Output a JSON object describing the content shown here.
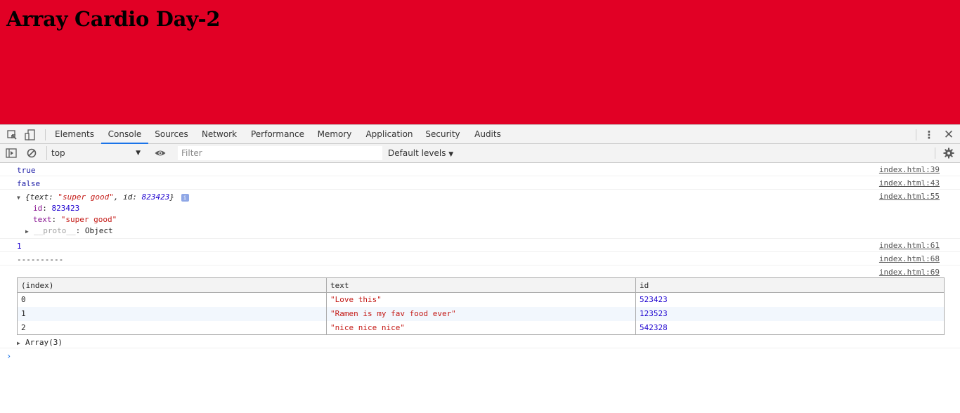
{
  "page": {
    "heading": "Array Cardio Day-2",
    "background": "#e10025"
  },
  "devtools": {
    "tabs": [
      {
        "label": "Elements",
        "active": false
      },
      {
        "label": "Console",
        "active": true
      },
      {
        "label": "Sources",
        "active": false
      },
      {
        "label": "Network",
        "active": false
      },
      {
        "label": "Performance",
        "active": false
      },
      {
        "label": "Memory",
        "active": false
      },
      {
        "label": "Application",
        "active": false
      },
      {
        "label": "Security",
        "active": false
      },
      {
        "label": "Audits",
        "active": false
      }
    ],
    "toolbar": {
      "context": "top",
      "filter_placeholder": "Filter",
      "levels": "Default levels"
    }
  },
  "console": {
    "messages": [
      {
        "text": "true",
        "source": "index.html:39"
      },
      {
        "text": "false",
        "source": "index.html:43"
      },
      {
        "source": "index.html:55",
        "summary_prefix": "{text: ",
        "summary_text": "\"super good\"",
        "summary_mid": ", id: ",
        "summary_id": "823423",
        "summary_suffix": "}",
        "info_badge": "i",
        "props": [
          {
            "key": "id",
            "value": "823423"
          },
          {
            "key": "text",
            "value": "\"super good\""
          },
          {
            "key": "__proto__",
            "value": "Object"
          }
        ]
      },
      {
        "text": "1",
        "source": "index.html:61"
      },
      {
        "text": "----------",
        "source": "index.html:68"
      },
      {
        "source": "index.html:69"
      }
    ],
    "table": {
      "headers": [
        "(index)",
        "text",
        "id"
      ],
      "rows": [
        {
          "index": "0",
          "text": "\"Love this\"",
          "id": "523423"
        },
        {
          "index": "1",
          "text": "\"Ramen is my fav food ever\"",
          "id": "123523"
        },
        {
          "index": "2",
          "text": "\"nice nice nice\"",
          "id": "542328"
        }
      ],
      "footer": "Array(3)"
    },
    "prompt": "›"
  }
}
